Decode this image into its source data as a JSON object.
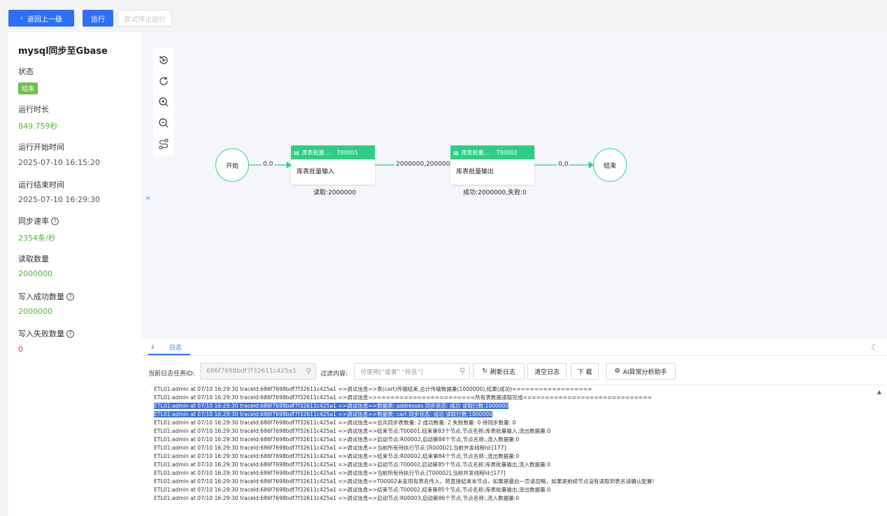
{
  "toolbar": {
    "back_label": "返回上一级",
    "run_label": "运行",
    "stop_label": "尝试停止运行"
  },
  "sidebar": {
    "title": "mysql同步至Gbase",
    "status_label": "状态",
    "status_value": "结束",
    "duration_label": "运行时长",
    "duration_value": "849.759秒",
    "start_label": "运行开始时间",
    "start_value": "2025-07-10 16:15:20",
    "end_label": "运行结束时间",
    "end_value": "2025-07-10 16:29:30",
    "rate_label": "同步速率",
    "rate_value": "2354条/秒",
    "read_label": "读取数量",
    "read_value": "2000000",
    "write_ok_label": "写入成功数量",
    "write_ok_value": "2000000",
    "write_fail_label": "写入失败数量",
    "write_fail_value": "0"
  },
  "flow": {
    "start_label": "开始",
    "end_label": "结束",
    "edge1": "0,0",
    "edge2": "2000000,2000000",
    "edge3": "0,0",
    "task1": {
      "name": "库表批量…",
      "id": "T00001",
      "body": "库表批量输入",
      "stat": "读取:2000000"
    },
    "task2": {
      "name": "库表批量…",
      "id": "T00002",
      "body": "库表批量输出",
      "stat": "成功:2000000,失败:0"
    },
    "accent": "#2fce86"
  },
  "log": {
    "tab_label": "日志",
    "task_id_label": "当前日志任务ID:",
    "task_id_value": "686f7698bdf7f32611c425a1",
    "filter_label": "过滤内容:",
    "filter_placeholder": "可使用[\"或者\" \"并且\"]",
    "refresh_label": "刷新日志",
    "clear_label": "清空日志",
    "download_label": "下 载",
    "ai_label": "AI异常分析助手",
    "lines": [
      "ETL01:admin at 07/10 16:29:30 traceId:686f7698bdf7f32611c425a1 =>调试信息=>表(cart)传输结束,总计传输数据量(1000000),结果(成功)==================",
      "ETL01:admin at 07/10 16:29:30 traceId:686f7698bdf7f32611c425a1 =>调试信息=>======================所有表数据读取完成=============================",
      "ETL01:admin at 07/10 16:29:30 traceId:686f7698bdf7f32611c425a1 =>调试信息=>数据表: addresses 同步状态: 成功 读取行数:1000000",
      "ETL01:admin at 07/10 16:29:30 traceId:686f7698bdf7f32611c425a1 =>调试信息=>数据表: cart 同步状态: 成功 读取行数:1000000",
      "ETL01:admin at 07/10 16:29:30 traceId:686f7698bdf7f32611c425a1 =>调试信息=>总共同步表数量: 2 成功数量: 2 失败数量: 0 待同步数量: 0",
      "ETL01:admin at 07/10 16:29:30 traceId:686f7698bdf7f32611c425a1 =>调试信息=>结束节点:T00001,结束第83个节点,节点名称:库表批量输入,流出数据量:0",
      "ETL01:admin at 07/10 16:29:30 traceId:686f7698bdf7f32611c425a1 =>调试信息=>启动节点:R00002,启动第84个节点,节点名称:,流入数据量:0",
      "ETL01:admin at 07/10 16:29:30 traceId:686f7698bdf7f32611c425a1 =>调试信息=>当前所有待执行节点:[R00002],当前并发线程Id:[177]",
      "ETL01:admin at 07/10 16:29:30 traceId:686f7698bdf7f32611c425a1 =>调试信息=>结束节点:R00002,结束第84个节点,节点名称:,流出数据量:0",
      "ETL01:admin at 07/10 16:29:30 traceId:686f7698bdf7f32611c425a1 =>调试信息=>启动节点:T00002,启动第85个节点,节点名称:库表批量输出,流入数据量:0",
      "ETL01:admin at 07/10 16:29:30 traceId:686f7698bdf7f32611c425a1 =>调试信息=>当前所有待执行节点:[T00002],当前并发线程Id:[177]",
      "ETL01:admin at 07/10 16:29:30 traceId:686f7698bdf7f32611c425a1 =>调试信息=>T00002未发现有表名传入，将直接结束本节点，如果是最后一页请忽略，如果是前续节点没有读取到表名请确认配置!",
      "ETL01:admin at 07/10 16:29:30 traceId:686f7698bdf7f32611c425a1 =>调试信息=>结束节点:T00002,结束第85个节点,节点名称:库表批量输出,流出数据量:0",
      "ETL01:admin at 07/10 16:29:30 traceId:686f7698bdf7f32611c425a1 =>调试信息=>启动节点:R00003,启动第86个节点,节点名称:,流入数据量:0"
    ]
  }
}
